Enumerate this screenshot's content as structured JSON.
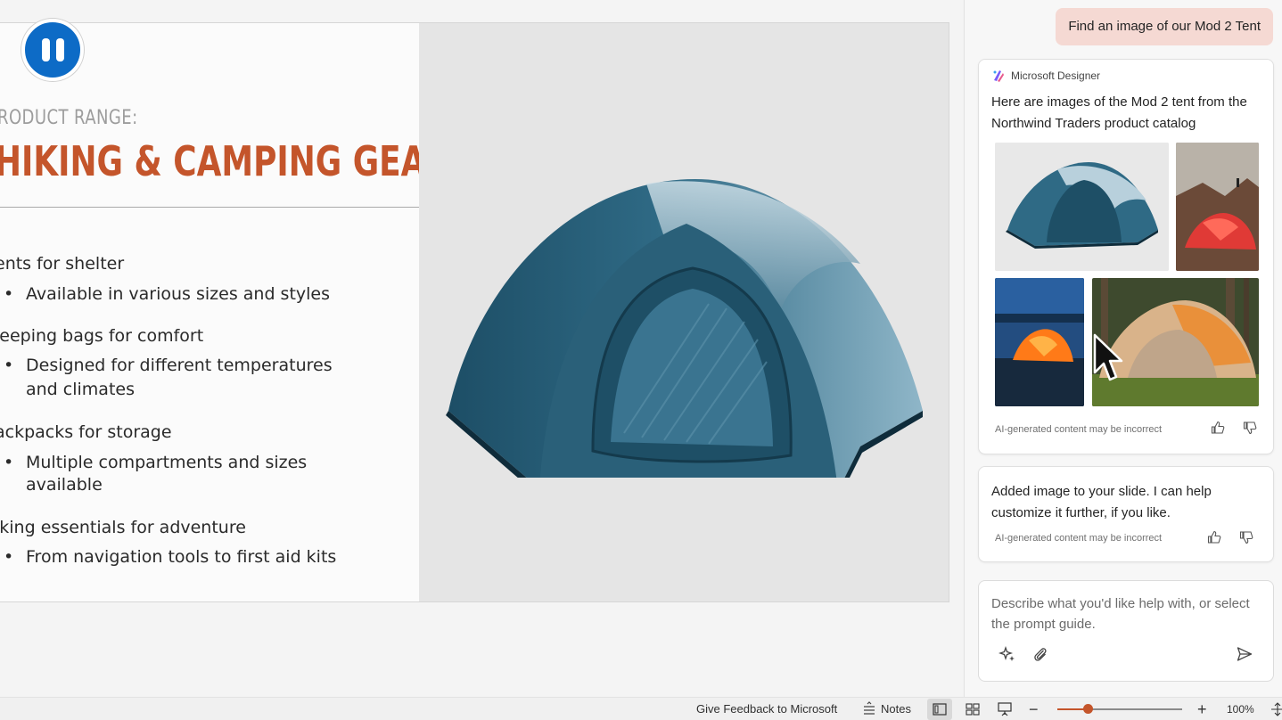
{
  "slide": {
    "subtitle": "RODUCT RANGE:",
    "title": "HIKING & CAMPING GEAR",
    "bullets": [
      {
        "main": "ents for shelter",
        "subs": [
          "Available in various sizes and styles"
        ]
      },
      {
        "main": "leeping bags for comfort",
        "subs": [
          "Designed for different temperatures",
          "and climates"
        ]
      },
      {
        "main": "ackpacks for storage",
        "subs": [
          "Multiple compartments and sizes",
          "available"
        ]
      },
      {
        "main": "iking essentials for adventure",
        "subs": [
          "From navigation tools to first aid kits"
        ]
      }
    ],
    "colors": {
      "title": "#c4552b",
      "subtitle": "#9d9d9d",
      "tent": "#2f6a85"
    }
  },
  "pause_button": {
    "icon": "pause-icon"
  },
  "copilot": {
    "user_message": "Find an image of our Mod 2 Tent",
    "response_card": {
      "source": "Microsoft Designer",
      "text": "Here are images of the Mod 2 tent from the Northwind Traders product catalog",
      "images": [
        "tent-blue-studio",
        "tent-red-mountain",
        "tent-orange-lake-night",
        "tent-beige-forest"
      ],
      "disclaimer": "AI-generated content may be incorrect"
    },
    "followup_card": {
      "text": "Added image to your slide.  I can help customize it further, if you like.",
      "disclaimer": "AI-generated content may be incorrect"
    },
    "composer": {
      "placeholder": "Describe what you'd like help with, or select the prompt guide."
    }
  },
  "statusbar": {
    "feedback": "Give Feedback to Microsoft",
    "notes": "Notes",
    "zoom_level": "100%",
    "zoom_minus": "−",
    "zoom_plus": "+",
    "zoom_fraction": 0.24
  }
}
